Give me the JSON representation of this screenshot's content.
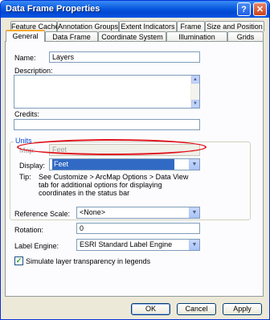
{
  "window": {
    "title": "Data Frame Properties",
    "help_glyph": "?",
    "close_glyph": "✕"
  },
  "tabs_row1": [
    "Feature Cache",
    "Annotation Groups",
    "Extent Indicators",
    "Frame",
    "Size and Position"
  ],
  "tabs_row2": [
    "General",
    "Data Frame",
    "Coordinate System",
    "Illumination",
    "Grids"
  ],
  "active_tab": "General",
  "general": {
    "name_label": "Name:",
    "name_value": "Layers",
    "description_label": "Description:",
    "description_value": "",
    "credits_label": "Credits:",
    "credits_value": "",
    "units": {
      "group_title": "Units",
      "map_label": "Map:",
      "map_value": "Feet",
      "display_label": "Display:",
      "display_value": "Feet",
      "tip_label": "Tip:",
      "tip_text": "See Customize > ArcMap Options > Data View tab for additional options for displaying coordinates in the status bar"
    },
    "reference_scale_label": "Reference Scale:",
    "reference_scale_value": "<None>",
    "rotation_label": "Rotation:",
    "rotation_value": "0",
    "label_engine_label": "Label Engine:",
    "label_engine_value": "ESRI Standard Label Engine",
    "transparency_label": "Simulate layer transparency in legends",
    "transparency_checked": true
  },
  "buttons": {
    "ok": "OK",
    "cancel": "Cancel",
    "apply": "Apply"
  },
  "icons": {
    "help": "help-icon",
    "close": "close-icon",
    "dropdown": "chevron-down-icon",
    "check": "check-icon"
  },
  "colors": {
    "titlebar": "#0a5ae0",
    "highlight": "#e0101a",
    "selection": "#316ac5",
    "group_title": "#0046d5"
  }
}
